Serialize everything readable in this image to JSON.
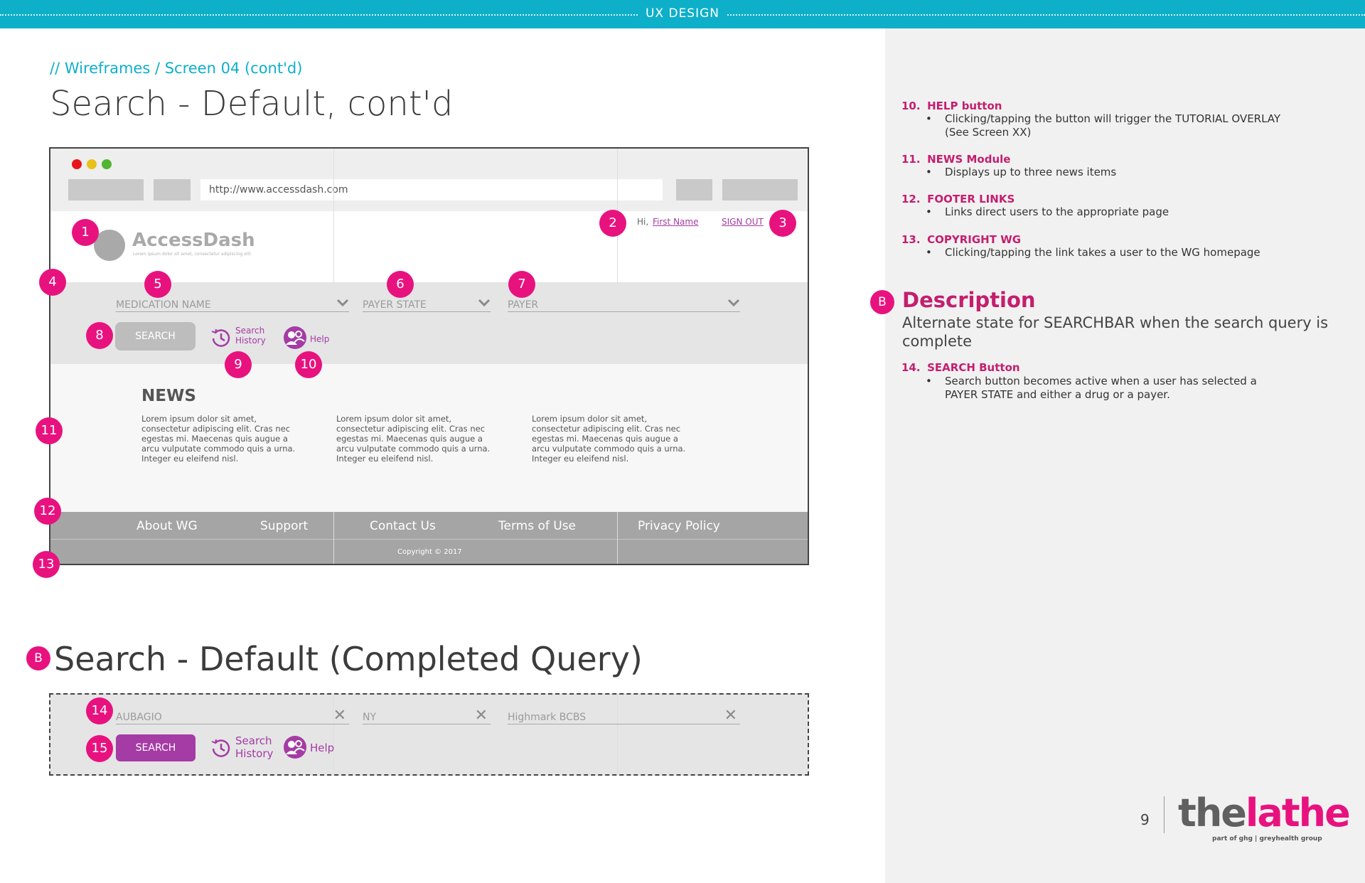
{
  "header": {
    "label": "UX DESIGN",
    "breadcrumb": "// Wireframes  / Screen 04 (cont'd)",
    "title": "Search - Default, cont'd"
  },
  "browser": {
    "url": "http://www.accessdash.com",
    "dots": [
      "#e8141b",
      "#e8c21b",
      "#52b532"
    ]
  },
  "site": {
    "logo_text": "AccessDash",
    "logo_tagline": "Lorem ipsum dolor sit amet, consectetur adipiscing elit.",
    "greeting": "Hi,",
    "first_name": "First Name",
    "sign_out": "SIGN OUT"
  },
  "searchbar": {
    "medication_placeholder": "MEDICATION NAME",
    "payer_state_placeholder": "PAYER STATE",
    "payer_placeholder": "PAYER",
    "search_label": "SEARCH",
    "search_history_line1": "Search",
    "search_history_line2": "History",
    "help_label": "Help"
  },
  "news": {
    "title": "NEWS",
    "items": [
      "Lorem ipsum dolor sit amet, consectetur adipiscing elit. Cras nec egestas mi. Maecenas quis augue a arcu vulputate commodo quis a urna. Integer eu eleifend nisl.",
      "Lorem ipsum dolor sit amet, consectetur adipiscing elit. Cras nec egestas mi. Maecenas quis augue a arcu vulputate commodo quis a urna. Integer eu eleifend nisl.",
      "Lorem ipsum dolor sit amet, consectetur adipiscing elit. Cras nec egestas mi. Maecenas quis augue a arcu vulputate commodo quis a urna. Integer eu eleifend nisl."
    ]
  },
  "footer": {
    "links": [
      "About WG",
      "Support",
      "Contact Us",
      "Terms of Use",
      "Privacy Policy"
    ],
    "copyright": "Copyright © 2017"
  },
  "markers": [
    "1",
    "2",
    "3",
    "4",
    "5",
    "6",
    "7",
    "8",
    "9",
    "10",
    "11",
    "12",
    "13",
    "14",
    "15"
  ],
  "section_b": {
    "marker": "B",
    "title": "Search - Default (Completed Query)",
    "medication_value": "AUBAGIO",
    "payer_state_value": "NY",
    "payer_value": "Highmark BCBS",
    "search_label": "SEARCH",
    "search_history_line1": "Search",
    "search_history_line2": "History",
    "help_label": "Help"
  },
  "notes": [
    {
      "num": "10.",
      "title": "HELP button",
      "bullets": [
        "Clicking/tapping the button will trigger the TUTORIAL OVERLAY (See Screen XX)"
      ]
    },
    {
      "num": "11.",
      "title": "NEWS Module",
      "bullets": [
        "Displays up to three news items"
      ]
    },
    {
      "num": "12.",
      "title": "FOOTER LINKS",
      "bullets": [
        "Links direct users to the appropriate page"
      ]
    },
    {
      "num": "13.",
      "title": "COPYRIGHT WG",
      "bullets": [
        "Clicking/tapping the link takes a user to the WG homepage"
      ]
    }
  ],
  "description": {
    "marker": "B",
    "title": "Description",
    "text": "Alternate state for SEARCHBAR when the search query is complete",
    "note_num": "14.",
    "note_title": "SEARCH Button",
    "note_bullet": "Search button becomes active when a user has selected a PAYER STATE and either a drug or a payer."
  },
  "page": {
    "number": "9",
    "brand_the": "the",
    "brand_lathe": "lathe",
    "brand_sub": "part of ghg | greyhealth group"
  },
  "colors": {
    "accent_teal": "#0eafc9",
    "marker_pink": "#e8127f",
    "heading_magenta": "#c41e6e",
    "purple": "#a53ba5"
  }
}
